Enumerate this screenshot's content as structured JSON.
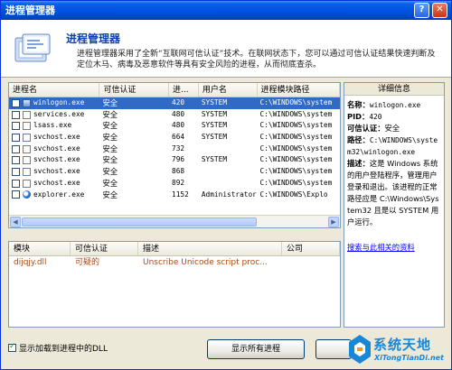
{
  "window": {
    "title": "进程管理器"
  },
  "header": {
    "title": "进程管理器",
    "description": "进程管理器采用了全新“互联网可信认证”技术。在联网状态下，您可以通过可信认证结果快速判断及定位木马、病毒及恶意软件等具有安全风险的进程，从而彻底查杀。"
  },
  "process_table": {
    "columns": [
      "进程名",
      "可信认证",
      "进...",
      "用户名",
      "进程模块路径"
    ],
    "rows": [
      {
        "name": "winlogon.exe",
        "cert": "安全",
        "pid": "420",
        "user": "SYSTEM",
        "path": "C:\\WINDOWS\\system",
        "icon": "app-icon",
        "selected": true
      },
      {
        "name": "services.exe",
        "cert": "安全",
        "pid": "480",
        "user": "SYSTEM",
        "path": "C:\\WINDOWS\\system",
        "icon": "doc-icon",
        "selected": false
      },
      {
        "name": "lsass.exe",
        "cert": "安全",
        "pid": "480",
        "user": "SYSTEM",
        "path": "C:\\WINDOWS\\system",
        "icon": "doc-icon",
        "selected": false
      },
      {
        "name": "svchost.exe",
        "cert": "安全",
        "pid": "664",
        "user": "SYSTEM",
        "path": "C:\\WINDOWS\\system",
        "icon": "doc-icon",
        "selected": false
      },
      {
        "name": "svchost.exe",
        "cert": "安全",
        "pid": "732",
        "user": "",
        "path": "C:\\WINDOWS\\system",
        "icon": "doc-icon",
        "selected": false
      },
      {
        "name": "svchost.exe",
        "cert": "安全",
        "pid": "796",
        "user": "SYSTEM",
        "path": "C:\\WINDOWS\\system",
        "icon": "doc-icon",
        "selected": false
      },
      {
        "name": "svchost.exe",
        "cert": "安全",
        "pid": "868",
        "user": "",
        "path": "C:\\WINDOWS\\system",
        "icon": "doc-icon",
        "selected": false
      },
      {
        "name": "svchost.exe",
        "cert": "安全",
        "pid": "892",
        "user": "",
        "path": "C:\\WINDOWS\\system",
        "icon": "doc-icon",
        "selected": false
      },
      {
        "name": "explorer.exe",
        "cert": "安全",
        "pid": "1152",
        "user": "Administrator",
        "path": "C:\\WINDOWS\\Explo",
        "icon": "explorer-icon",
        "selected": false
      }
    ]
  },
  "detail": {
    "heading": "详细信息",
    "name_label": "名称：",
    "name_value": "winlogon.exe",
    "pid_label": "PID：",
    "pid_value": "420",
    "cert_label": "可信认证：",
    "cert_value": "安全",
    "path_label": "路径：",
    "path_value": "C:\\WINDOWS\\system32\\winlogon.exe",
    "desc_label": "描述：",
    "desc_value": "这是 Windows 系统的用户登陆程序，管理用户登录和退出。该进程的正常路径应是 C:\\Windows\\System32 且是以 SYSTEM 用户运行。",
    "link": "搜索与此相关的资料"
  },
  "module_table": {
    "columns": [
      "模块",
      "可信认证",
      "描述",
      "公司"
    ],
    "rows": [
      {
        "module": "dijqjy.dll",
        "cert": "可疑的",
        "desc": "Unscribe Unicode script proc...",
        "company": ""
      }
    ]
  },
  "footer": {
    "show_dll_checkbox": "显示加载到进程中的DLL",
    "show_all_button": "显示所有进程"
  },
  "watermark": {
    "main": "系统天地",
    "sub": "XiTongTianDi.net"
  },
  "colors": {
    "selection": "#316ac5",
    "title_blue": "#0054e3",
    "suspicious": "#a64c16",
    "link": "#0000ff"
  }
}
